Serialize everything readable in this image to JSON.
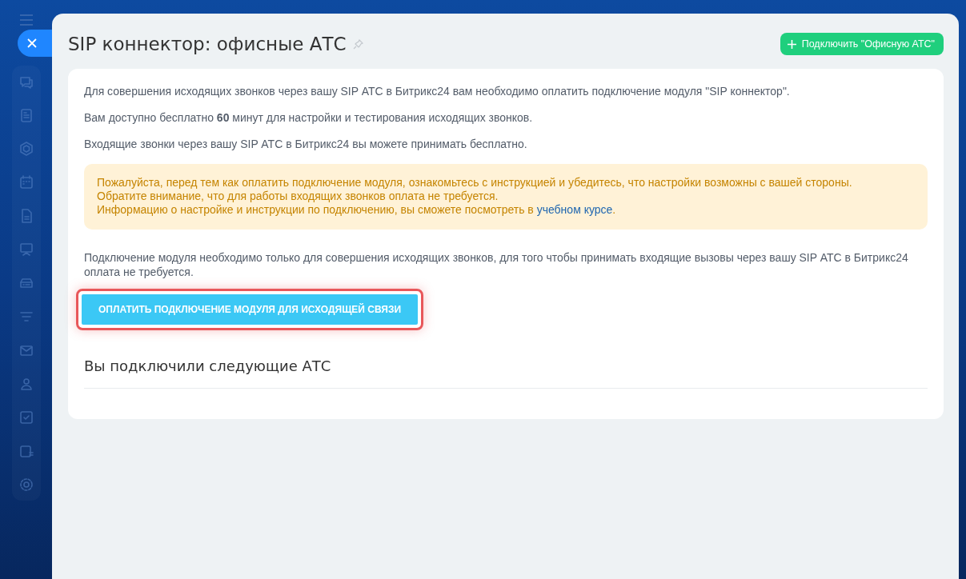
{
  "title": "SIP коннектор: офисные АТС",
  "header_button": {
    "label": "Подключить \"Офисную АТС\""
  },
  "paragraphs": [
    "Для совершения исходящих звонков через вашу SIP АТС в Битрикс24 вам необходимо оплатить подключение модуля \"SIP коннектор\".",
    "Вам доступно бесплатно **60** минут для настройки и тестирования исходящих звонков.",
    "Входящие звонки через вашу SIP АТС в Битрикс24 вы можете принимать бесплатно."
  ],
  "notice": {
    "lines": [
      "Пожалуйста, перед тем как оплатить подключение модуля, ознакомьтесь с инструкцией и убедитесь, что настройки возможны с вашей стороны.",
      "Обратите внимание, что для работы входящих звонков оплата не требуется."
    ],
    "last_line": "Информацию о настройке и инструкции по подключению, вы сможете посмотреть в ",
    "link": "учебном курсе",
    "last_suffix": "."
  },
  "info_text": "Подключение модуля необходимо только для совершения исходящих звонков, для того чтобы принимать входящие вызовы через вашу SIP АТС в Битрикс24 оплата не требуется.",
  "pay_button": {
    "label": "ОПЛАТИТЬ ПОДКЛЮЧЕНИЕ МОДУЛЯ ДЛЯ ИСХОДЯЩЕЙ СВЯЗИ",
    "highlighted": true
  },
  "section_title": "Вы подключили следующие АТС"
}
